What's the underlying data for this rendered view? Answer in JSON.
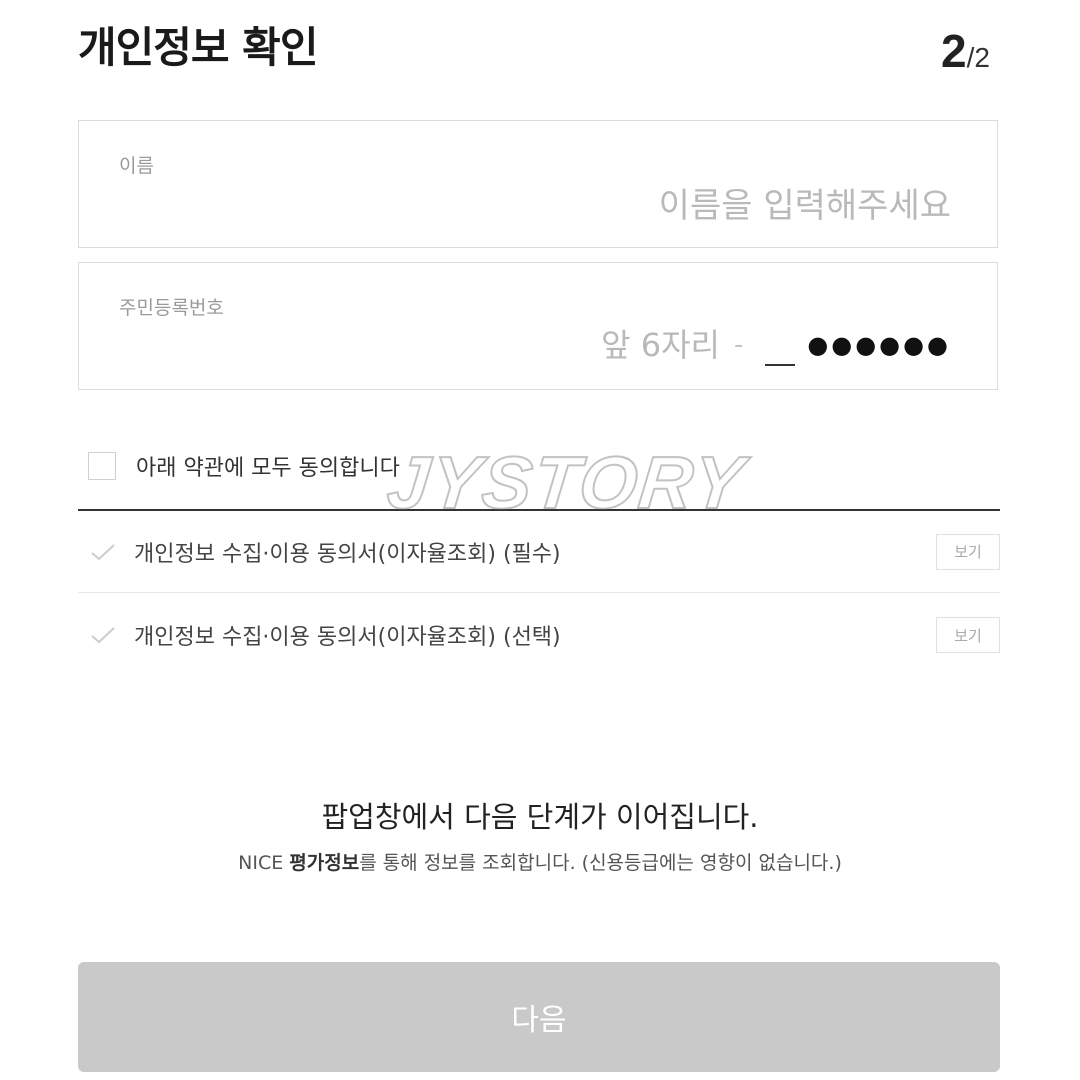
{
  "header": {
    "title": "개인정보 확인",
    "step_current": "2",
    "step_total": "/2"
  },
  "name_field": {
    "label": "이름",
    "placeholder": "이름을 입력해주세요",
    "value": ""
  },
  "rrn_field": {
    "label": "주민등록번호",
    "front_placeholder": "앞 6자리",
    "dash": "-",
    "masked": "●●●●●●"
  },
  "agreement": {
    "all_label": "아래 약관에 모두 동의합니다",
    "all_checked": false,
    "terms": [
      {
        "label": "개인정보 수집·이용 동의서(이자율조회) (필수)",
        "view_label": "보기"
      },
      {
        "label": "개인정보 수집·이용 동의서(이자율조회) (선택)",
        "view_label": "보기"
      }
    ]
  },
  "notice": {
    "title": "팝업창에서 다음 단계가 이어집니다.",
    "sub_prefix": "NICE ",
    "sub_strong": "평가정보",
    "sub_suffix": "를 통해 정보를 조회합니다. (신용등급에는 영향이 없습니다.)"
  },
  "next_button": {
    "label": "다음"
  },
  "watermark": {
    "text": "JYSTORY"
  },
  "colors": {
    "button_disabled": "#c9c9c9",
    "border": "#dcdcdc",
    "placeholder": "#b9b9b9",
    "checkmark": "#cccccc"
  }
}
